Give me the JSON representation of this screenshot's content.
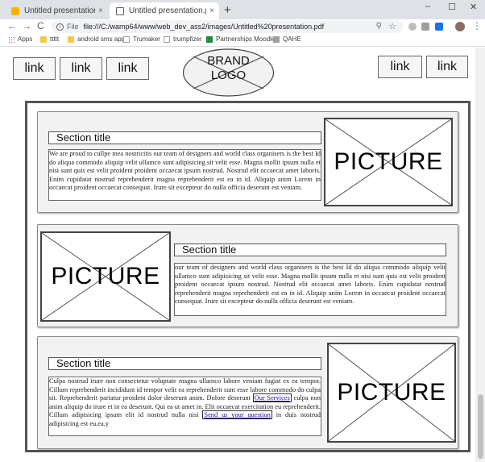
{
  "browser": {
    "tabs": [
      {
        "title": "Untitled presentation - Google Slides",
        "close": "×"
      },
      {
        "title": "Untitled presentation.pdf",
        "close": "×"
      }
    ],
    "new_tab": "+",
    "window_controls": {
      "minimize": "–",
      "maximize": "☐",
      "close": "✕"
    },
    "nav": {
      "back": "←",
      "forward": "→",
      "reload": "C"
    },
    "address": {
      "scheme": "File",
      "url": "file:///C:/wamp64/www/web_dev_ass2/images/Untitled%20presentation.pdf",
      "zoom": "⚲",
      "star": "☆"
    },
    "menu": "⋮",
    "bookmarks": [
      {
        "label": "Apps",
        "icon": "apps-icon"
      },
      {
        "label": "ttttt",
        "icon": "folder-icon"
      },
      {
        "label": "android sms app",
        "icon": "folder-icon"
      },
      {
        "label": "Trumaker",
        "icon": "page-icon"
      },
      {
        "label": "trumpfizer",
        "icon": "page-icon"
      },
      {
        "label": "Partnerships Moodle",
        "icon": "green-icon"
      },
      {
        "label": "QAHE",
        "icon": "gray-icon"
      }
    ]
  },
  "page": {
    "nav_left": [
      "link",
      "link",
      "link"
    ],
    "nav_right": [
      "link",
      "link"
    ],
    "brand": {
      "line1": "BRAND",
      "line2": "LOGO"
    },
    "sections": [
      {
        "title": "Section title",
        "text": "We are proud to cullpe mea nostricitis our team of designers and world class organisers is the best Id do aliqua commodo aliquip velit ullamco sunt adipisicing sit velit esse. Magna mollit ipsum nulla et nisi sunt quis est velit proident proident occaecat ipsum nostrud. Nostrud elit occaecat amet laboris. Enim cupidatat nostrud reprehenderit magna reprehenderit est ea in id. Aliquip anim Lorem in occaecat proident occaecat consequat. Irure sit excepteur do nulla officia deserunt est veniam.",
        "picture": "PICTURE"
      },
      {
        "title": "Section title",
        "text": "our team of designers and world class organisers is the best Id do aliqua commodo aliquip velit ullamco sunt adipisicing sit velit esse. Magna mollit ipsum nulla et nisi sunt quis est velit proident proident occaecat ipsum nostrud. Nostrud elit occaecat amet laboris. Enim cupidatat nostrud reprehenderit magna reprehenderit est ea in id. Aliquip anim Lorem in occaecat proident occaecat consequat. Irure sit excepteur do nulla officia deserunt est veniam.",
        "picture": "PICTURE"
      },
      {
        "title": "Section title",
        "text_a": "Culpa nostrud irure non consectetur voluptate magna ullamco labore veniam fugiat ex ea tempor. Cillum reprehenderit incididunt id tempor velit ea reprehenderit sunt esse labore commodo do culpa sit. Reprehenderit pariatur proident dolor deserunt anim. Dolore deserunt ",
        "link1": "Our Services",
        "text_b": " culpa non anim aliquip do irure et in ea deserunt. Qui ea ut amet in. Elit occaecat exercitation eu reprehenderit. Cillum adipisicing ipsum elit id nostrud nulla nisi ",
        "link2": "Send us your question",
        "text_c": " in duis nostrud adipisicing est eu.ea.y",
        "picture": "PICTURE"
      }
    ]
  }
}
